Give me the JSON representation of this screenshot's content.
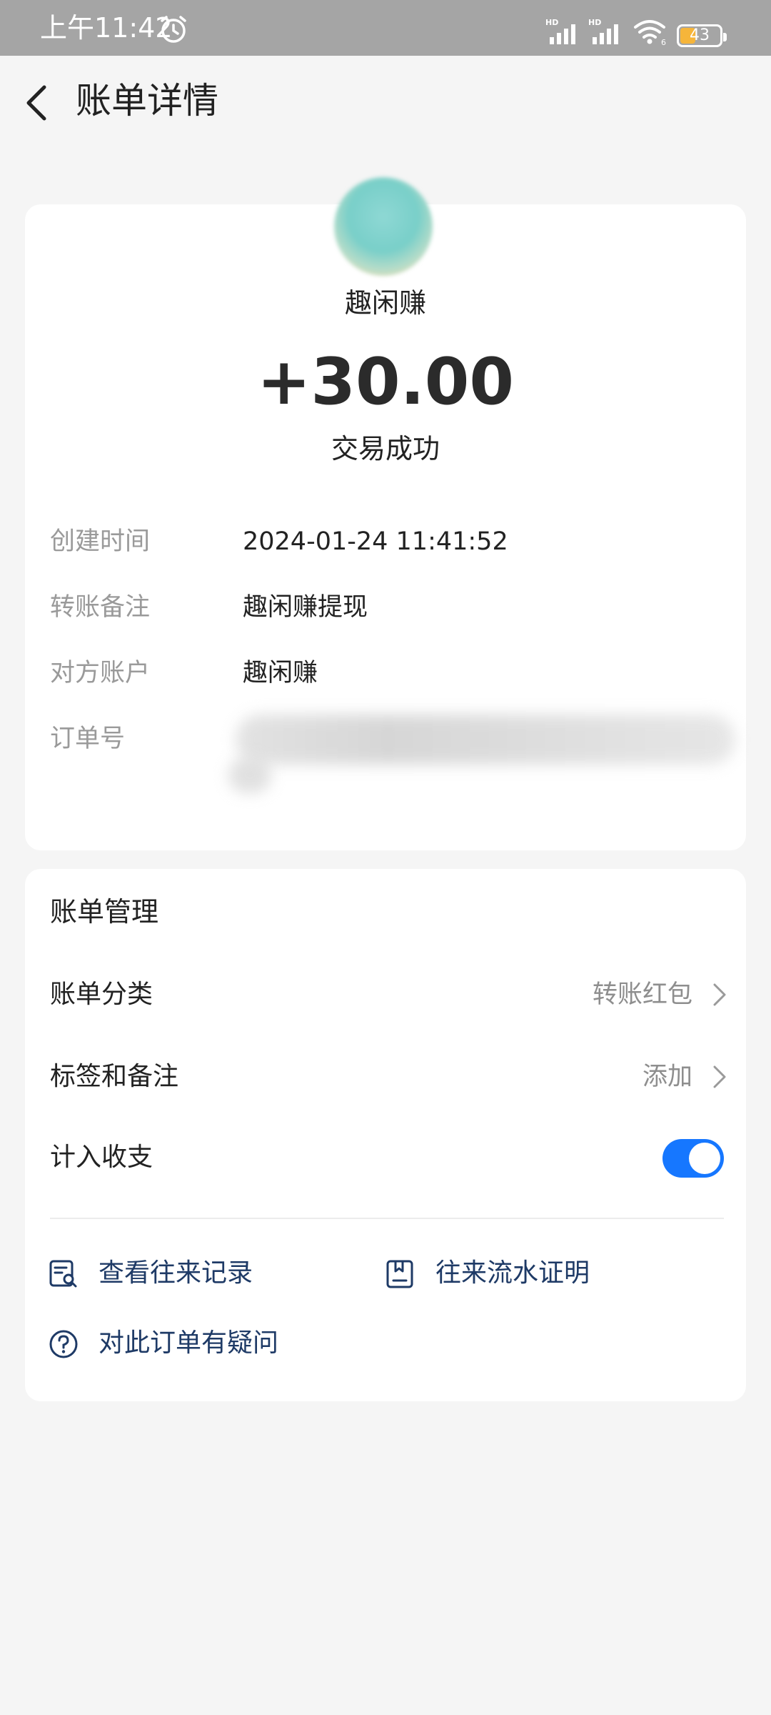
{
  "status_bar": {
    "time": "上午11:42",
    "battery_level": 43,
    "battery_text": "43",
    "signal_label_1": "HD",
    "signal_label_2": "HD",
    "wifi_badge": "6"
  },
  "header": {
    "title": "账单详情"
  },
  "transaction": {
    "merchant": "趣闲赚",
    "amount": "+30.00",
    "status": "交易成功",
    "details": [
      {
        "label": "创建时间",
        "value": "2024-01-24 11:41:52"
      },
      {
        "label": "转账备注",
        "value": "趣闲赚提现"
      },
      {
        "label": "对方账户",
        "value": "趣闲赚"
      },
      {
        "label": "订单号",
        "value": ""
      }
    ]
  },
  "manage": {
    "title": "账单管理",
    "category_label": "账单分类",
    "category_value": "转账红包",
    "tags_label": "标签和备注",
    "tags_value": "添加",
    "include_label": "计入收支",
    "include_enabled": true,
    "links": {
      "history": "查看往来记录",
      "proof": "往来流水证明",
      "question": "对此订单有疑问"
    }
  },
  "colors": {
    "accent": "#1677ff",
    "link": "#1e3a66",
    "status_bar": "#a5a5a5",
    "background": "#f5f5f5"
  }
}
